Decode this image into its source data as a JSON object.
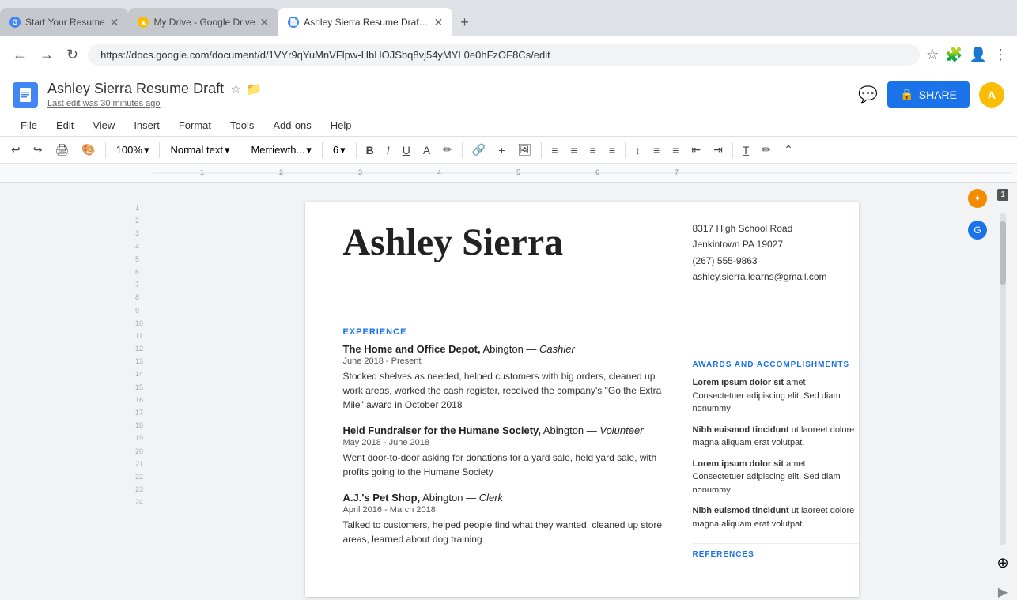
{
  "tabs": [
    {
      "id": "tab1",
      "title": "Start Your Resume",
      "favicon_type": "google",
      "favicon_letter": "G",
      "active": false
    },
    {
      "id": "tab2",
      "title": "My Drive - Google Drive",
      "favicon_type": "drive",
      "favicon_letter": "D",
      "active": false
    },
    {
      "id": "tab3",
      "title": "Ashley Sierra Resume Draft - C",
      "favicon_type": "docs",
      "favicon_letter": "D",
      "active": true
    }
  ],
  "browser": {
    "address": "https://docs.google.com/document/d/1VYr9qYuMnVFlpw-HbHOJSbq8vj54yMYL0e0hFzOF8Cs/edit",
    "back_disabled": false,
    "forward_disabled": true
  },
  "docs": {
    "icon_letter": "D",
    "title": "Ashley Sierra Resume Draft",
    "last_edit": "Last edit was 30 minutes ago",
    "share_label": "SHARE",
    "menu_items": [
      "File",
      "Edit",
      "View",
      "Insert",
      "Format",
      "Tools",
      "Add-ons",
      "Help"
    ],
    "toolbar": {
      "zoom": "100%",
      "style": "Normal text",
      "font": "Merriewth...",
      "font_size": "6",
      "zoom_label": "100%"
    },
    "page_count": "1"
  },
  "document": {
    "name": "Ashley Sierra",
    "contact": {
      "address": "8317 High School Road",
      "city_state": "Jenkintown PA 19027",
      "phone": "(267) 555-9863",
      "email": "ashley.sierra.learns@gmail.com"
    },
    "sections": {
      "experience_label": "EXPERIENCE",
      "jobs": [
        {
          "company": "The Home and Office Depot,",
          "location": "Abington —",
          "role": "Cashier",
          "dates": "June 2018 - Present",
          "description": "Stocked shelves as needed, helped customers with big orders, cleaned up work areas, worked the cash register, received the company's \"Go the Extra Mile\" award in October 2018"
        },
        {
          "company": "Held Fundraiser for the Humane Society,",
          "location": "Abington —",
          "role": "Volunteer",
          "dates": "May 2018 - June 2018",
          "description": "Went door-to-door asking for donations for a yard sale, held yard sale, with profits going to the Humane Society"
        },
        {
          "company": "A.J.'s Pet Shop,",
          "location": "Abington —",
          "role": "Clerk",
          "dates": "April 2016 - March 2018",
          "description": "Talked to customers, helped people find what they wanted, cleaned up store areas, learned about dog training"
        }
      ],
      "awards_label": "AWARDS AND ACCOMPLISHMENTS",
      "awards": [
        {
          "text_bold": "Lorem ipsum dolor",
          "text_bold2": "sit",
          "text_rest": " amet Consectetuer adipiscing elit, Sed diam nonummy"
        },
        {
          "text_bold": "Nibh euismod tincidunt",
          "text_rest": " ut laoreet dolore magna aliquam erat volutpat."
        },
        {
          "text_bold": "Lorem ipsum dolor",
          "text_bold2": "sit",
          "text_rest": " amet Consectetuer adipiscing elit, Sed diam nonummy"
        },
        {
          "text_bold": "Nibh euismod tincidunt",
          "text_rest": " ut laoreet dolore magna aliquam erat volutpat."
        }
      ],
      "references_label": "REFERENCES"
    }
  },
  "sidebar_right": {
    "icons": [
      "comment",
      "star",
      "edit"
    ]
  }
}
